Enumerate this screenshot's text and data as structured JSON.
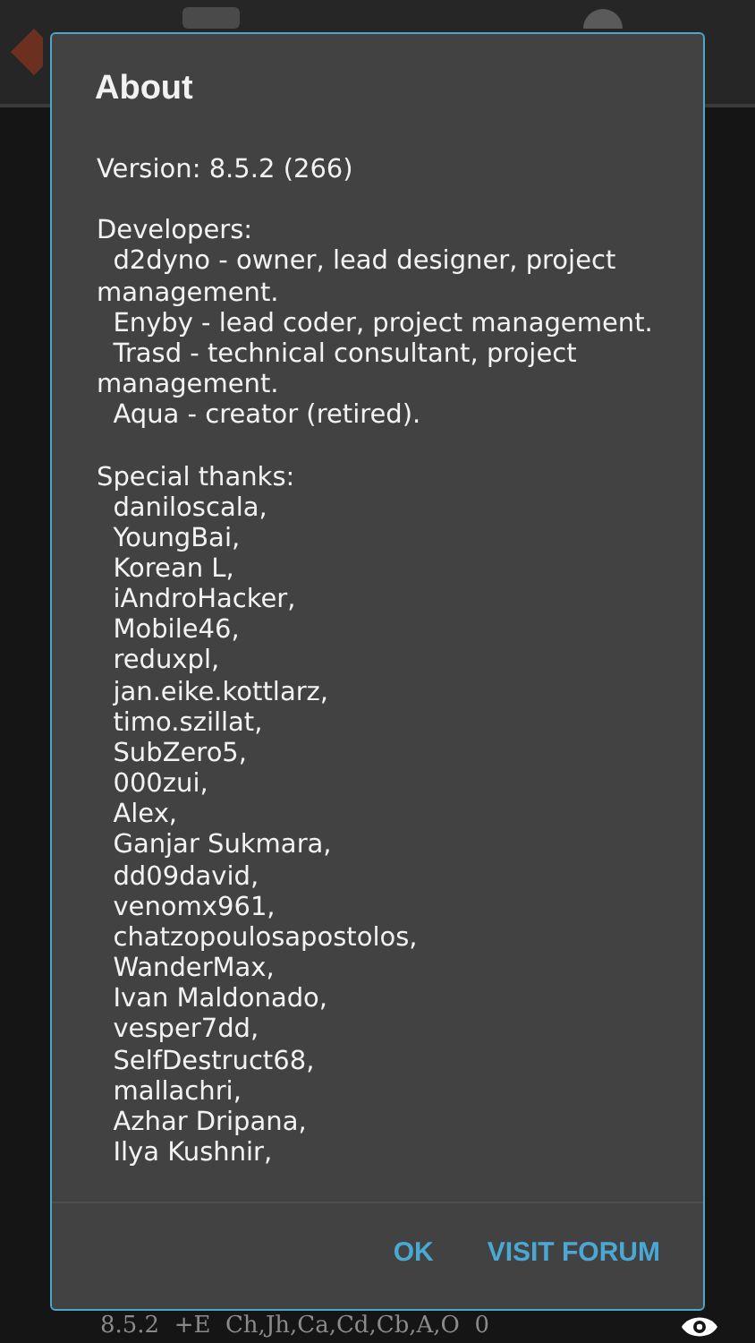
{
  "dialog": {
    "title": "About",
    "version": "Version: 8.5.2 (266)",
    "developers": {
      "heading": "Developers:",
      "items": [
        "d2dyno - owner, lead designer, project management.",
        "Enyby - lead coder, project management.",
        "Trasd - technical consultant, project management.",
        "Aqua - creator (retired)."
      ]
    },
    "thanks": {
      "heading": "Special thanks:",
      "items": [
        "daniloscala,",
        "YoungBai,",
        "Korean L,",
        "iAndroHacker,",
        "Mobile46,",
        "reduxpl,",
        "jan.eike.kottlarz,",
        "timo.szillat,",
        "SubZero5,",
        "000zui,",
        "Alex,",
        "Ganjar Sukmara,",
        "dd09david,",
        "venomx961,",
        "chatzopoulosapostolos,",
        "WanderMax,",
        "Ivan Maldonado,",
        "vesper7dd,",
        "SelfDestruct68,",
        "mallachri,",
        "Azhar Dripana,",
        "Ilya Kushnir,"
      ]
    },
    "buttons": [
      "OK",
      "VISIT FORUM"
    ]
  },
  "status_bar": {
    "text": "8.5.2  +E  Ch,Jh,Ca,Cd,Cb,A,O  0"
  }
}
